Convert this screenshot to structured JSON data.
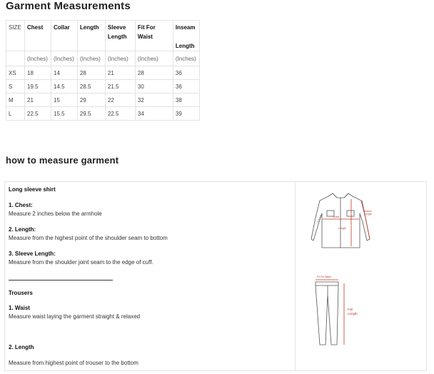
{
  "title": "Garment Measurements",
  "table": {
    "headers": [
      [
        "SIZE"
      ],
      [
        "Chest"
      ],
      [
        "Collar"
      ],
      [
        "Length"
      ],
      [
        "Sleeve",
        "Length"
      ],
      [
        "Fit For",
        "Waist"
      ],
      [
        "Inseam",
        "Length"
      ]
    ],
    "units": [
      "",
      "(Inches)",
      "(Inches)",
      "(Inches)",
      "(Inches)",
      "(Inches)",
      "(Inches)"
    ],
    "rows": [
      [
        "XS",
        "18",
        "14",
        "28",
        "21",
        "28",
        "36"
      ],
      [
        "S",
        "19.5",
        "14.5",
        "28.5",
        "21.5",
        "30",
        "36"
      ],
      [
        "M",
        "21",
        "15",
        "29",
        "22",
        "32",
        "38"
      ],
      [
        "L",
        "22.5",
        "15.5",
        "29.5",
        "22.5",
        "34",
        "39"
      ]
    ]
  },
  "how_to": {
    "title": "how to measure garment",
    "shirt_title": "Long sleeve shirt",
    "chest_label": "1. Chest:",
    "chest_desc": "Measure 2 inches below the armhole",
    "length_label": "2. Length:",
    "length_desc": "Measure from the highest point of the shoulder seam to bottom",
    "sleeve_label": "3. Sleeve Length:",
    "sleeve_desc": "Measure from the shoulder joint seam to the edge of cuff.",
    "trousers_title": "Trousers",
    "waist_label": "1. Waist",
    "waist_desc": "Measure waist laying the garment straight & relaxed",
    "tlength_label": "2. Length",
    "tlength_desc": "Measure from highest point of trouser to the bottom",
    "shirt_diagram": {
      "chest": "Chest",
      "length": "Length",
      "sleeve": [
        "Sleeve",
        "Length"
      ]
    },
    "trouser_diagram": {
      "waist": "Fit For Waist",
      "length": [
        "Full",
        "Length"
      ]
    }
  },
  "colors": {
    "annotation": "#c0392b",
    "line": "#555555",
    "border": "#e3e3e3"
  }
}
